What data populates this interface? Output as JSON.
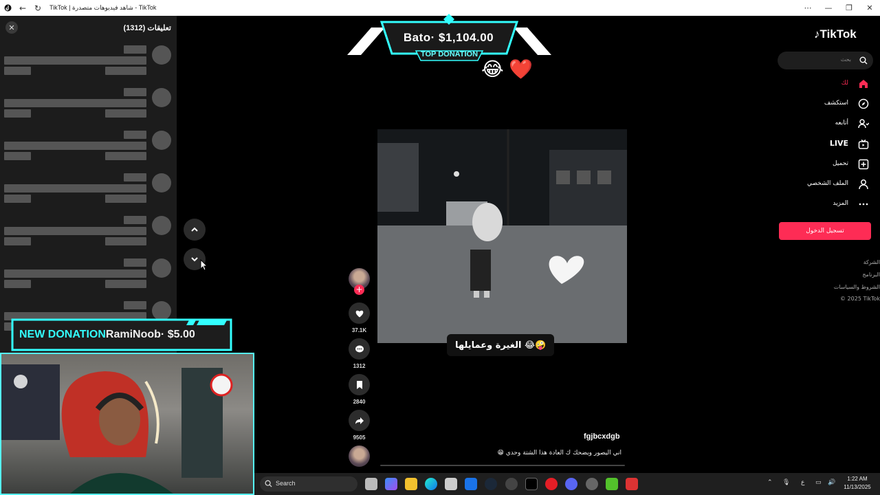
{
  "window": {
    "title": "TikTok | شاهد فيديوهات متصدرة - TikTok"
  },
  "comments": {
    "title": "تعليقات (1312)"
  },
  "overlay": {
    "top_donation_amount": "Bato· $1,104.00",
    "top_donation_label": "TOP DONATION",
    "new_donation_label": "NEW DONATION",
    "new_donation_detail": "RamiNoob· $5.00",
    "emojis": [
      "😂",
      "❤️"
    ]
  },
  "video": {
    "caption": "الغيرة وعمايلها 😂🤪",
    "author": "fgjbcxdgb",
    "description": "اني اليصور ويضحك ك العادة هذا الشتة وحدي 😁",
    "progress": 0.0
  },
  "actions": {
    "likes": "37.1K",
    "comments": "1312",
    "saves": "2840",
    "shares": "9505"
  },
  "sidebar": {
    "logo": "TikTok",
    "search_placeholder": "بحث",
    "nav": [
      {
        "label": "لك",
        "icon": "home-icon",
        "active": true
      },
      {
        "label": "استكشف",
        "icon": "compass-icon"
      },
      {
        "label": "أتابعه",
        "icon": "following-icon"
      },
      {
        "label": "LIVE",
        "icon": "live-icon"
      },
      {
        "label": "تحميل",
        "icon": "upload-icon"
      },
      {
        "label": "الملف الشخصي",
        "icon": "profile-icon"
      },
      {
        "label": "المزيد",
        "icon": "more-icon"
      }
    ],
    "login_label": "تسجيل الدخول",
    "footer": [
      "الشركة",
      "البرنامج",
      "الشروط والسياسات",
      "© 2025 TikTok"
    ],
    "accent_color": "#fe2c55"
  },
  "taskbar": {
    "search_label": "Search",
    "time": "1:22 AM",
    "date": "11/13/2025",
    "lang": "ع"
  }
}
